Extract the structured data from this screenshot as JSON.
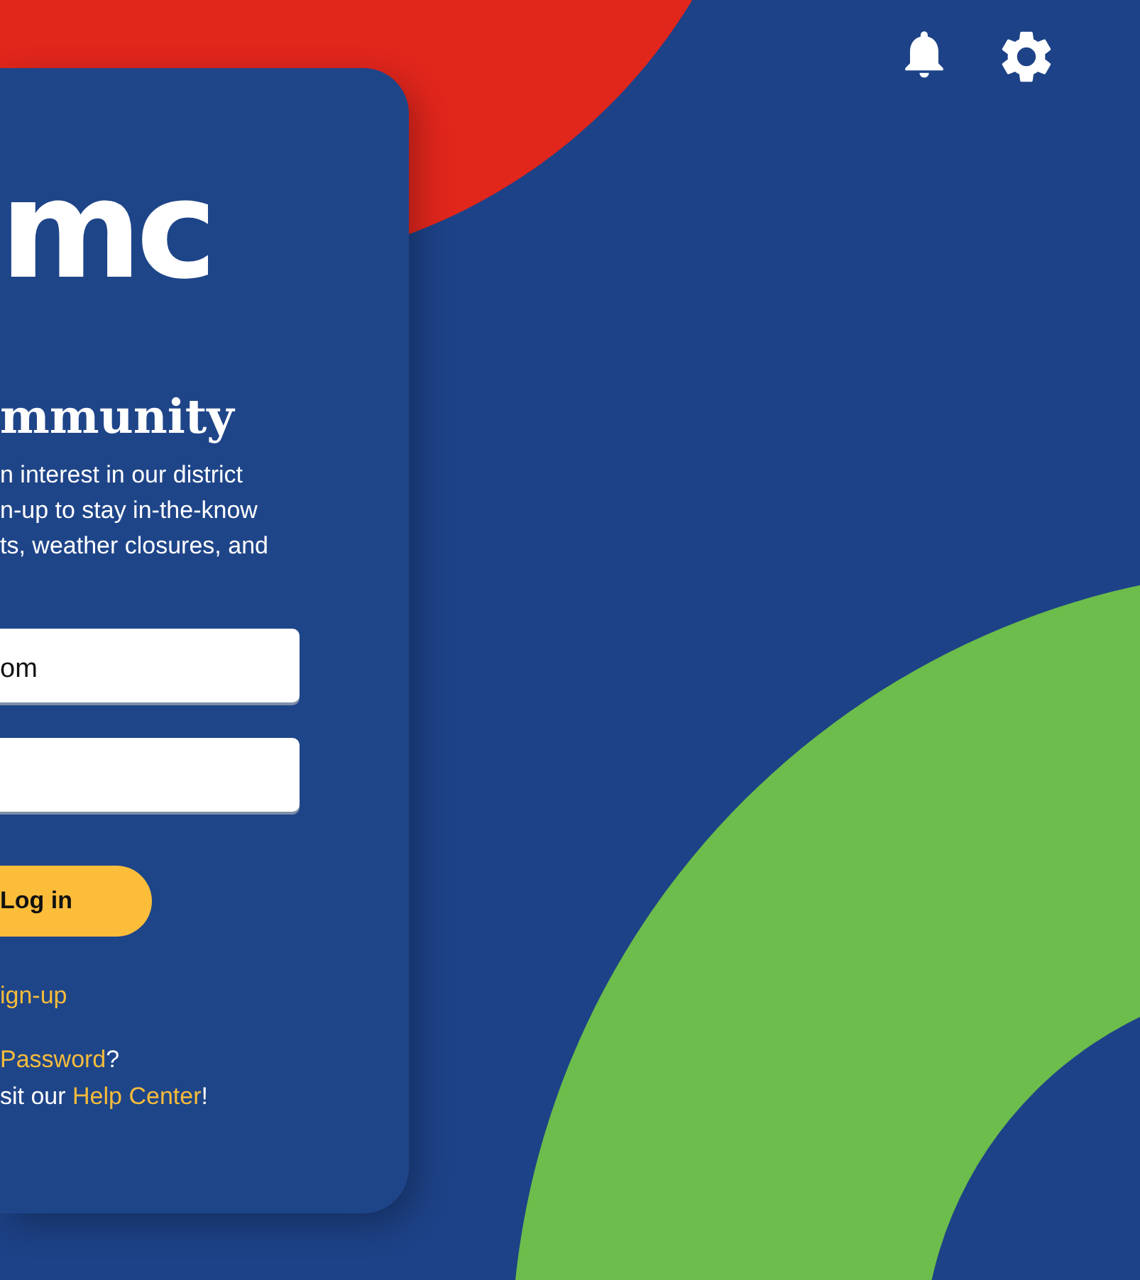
{
  "card": {
    "logo": "mc",
    "heading": "mmunity",
    "intro": [
      "n interest in our district",
      "n-up to stay in-the-know",
      "ts, weather closures, and"
    ],
    "email_field": {
      "value": "om"
    },
    "login_button": "Log in",
    "signup_link": "ign-up",
    "forgot": {
      "link": "Password",
      "after": "?"
    },
    "help": {
      "before": "sit our ",
      "link": "Help Center",
      "after": "!"
    }
  }
}
